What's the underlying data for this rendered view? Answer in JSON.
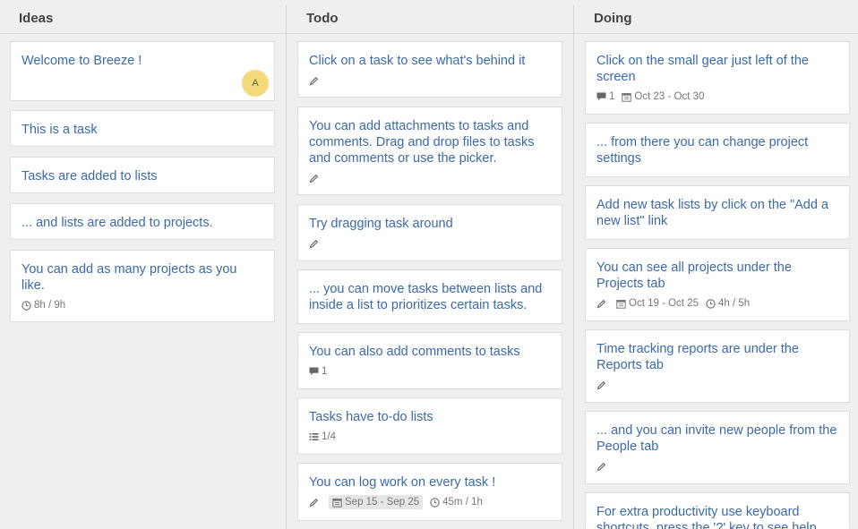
{
  "columns": {
    "ideas": {
      "title": "Ideas",
      "cards": [
        {
          "title": "Welcome to Breeze !",
          "avatar": "A"
        },
        {
          "title": "This is a task"
        },
        {
          "title": "Tasks are added to lists"
        },
        {
          "title": "... and lists are added to projects."
        },
        {
          "title": "You can add as many projects as you like.",
          "time": "8h / 9h"
        }
      ]
    },
    "todo": {
      "title": "Todo",
      "cards": [
        {
          "title": "Click on a task to see what's behind it"
        },
        {
          "title": "You can add attachments to tasks and comments. Drag and drop files to tasks and comments or use the picker."
        },
        {
          "title": "Try dragging task around"
        },
        {
          "title": "... you can move tasks between lists and inside a list to prioritizes certain tasks."
        },
        {
          "title": "You can also add comments to tasks",
          "comments": "1"
        },
        {
          "title": "Tasks have to-do lists",
          "todos": "1/4"
        },
        {
          "title": "You can log work on every task !",
          "dates": "Sep 15 - Sep 25",
          "time": "45m / 1h"
        }
      ]
    },
    "doing": {
      "title": "Doing",
      "cards": [
        {
          "title": "Click on the small gear just left of the screen",
          "comments": "1",
          "dates": "Oct 23 - Oct 30"
        },
        {
          "title": "... from there you can change project settings"
        },
        {
          "title": "Add new task lists by click on the \"Add a new list\" link"
        },
        {
          "title": "You can see all projects under the Projects tab",
          "dates": "Oct 19 - Oct 25",
          "time": "4h / 5h"
        },
        {
          "title": "Time tracking reports are under the Reports tab"
        },
        {
          "title": "... and you can invite new people from the People tab"
        },
        {
          "title": "For extra productivity use keyboard shortcuts, press the '?' key to see help"
        }
      ]
    }
  },
  "icons": {
    "edit": "pencil-icon",
    "comment": "comment-icon",
    "calendar": "calendar-icon",
    "clock": "clock-icon",
    "checklist": "checklist-icon"
  },
  "colors": {
    "card_title": "#3b6aa8",
    "avatar_bg": "#f3da7c"
  }
}
